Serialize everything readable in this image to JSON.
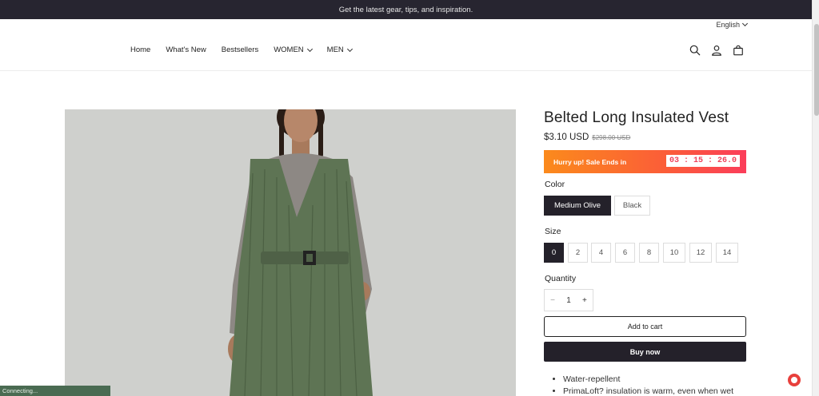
{
  "announcement": "Get the latest gear, tips, and inspiration.",
  "language": "English",
  "nav": {
    "items": [
      {
        "label": "Home"
      },
      {
        "label": "What's New"
      },
      {
        "label": "Bestsellers"
      },
      {
        "label": "WOMEN"
      },
      {
        "label": "MEN"
      }
    ]
  },
  "header_icons": [
    "search-icon",
    "account-icon",
    "cart-icon"
  ],
  "product": {
    "title": "Belted Long Insulated Vest",
    "price": "$3.10 USD",
    "compare_price": "$298.00 USD",
    "sale_message": "Hurry up! Sale Ends in",
    "timer": "03 : 15 : 26.0",
    "color_label": "Color",
    "colors": [
      "Medium Olive",
      "Black"
    ],
    "selected_color": "Medium Olive",
    "size_label": "Size",
    "sizes": [
      "0",
      "2",
      "4",
      "6",
      "8",
      "10",
      "12",
      "14"
    ],
    "selected_size": "0",
    "quantity_label": "Quantity",
    "quantity": "1",
    "qty_minus": "−",
    "qty_plus": "+",
    "add_to_cart": "Add to cart",
    "buy_now": "Buy now",
    "features": [
      "Water-repellent",
      "PrimaLoft? insulation is warm, even when wet"
    ]
  },
  "status_text": "Connecting...",
  "colors": {
    "topbar": "#272530",
    "dark_button": "#24212a",
    "sale_gradient_start": "#fb8a1c",
    "sale_gradient_end": "#fb3d5a",
    "timer_text": "#f0405a",
    "vest": "#5e7454",
    "status_bar": "#4a6b52"
  }
}
